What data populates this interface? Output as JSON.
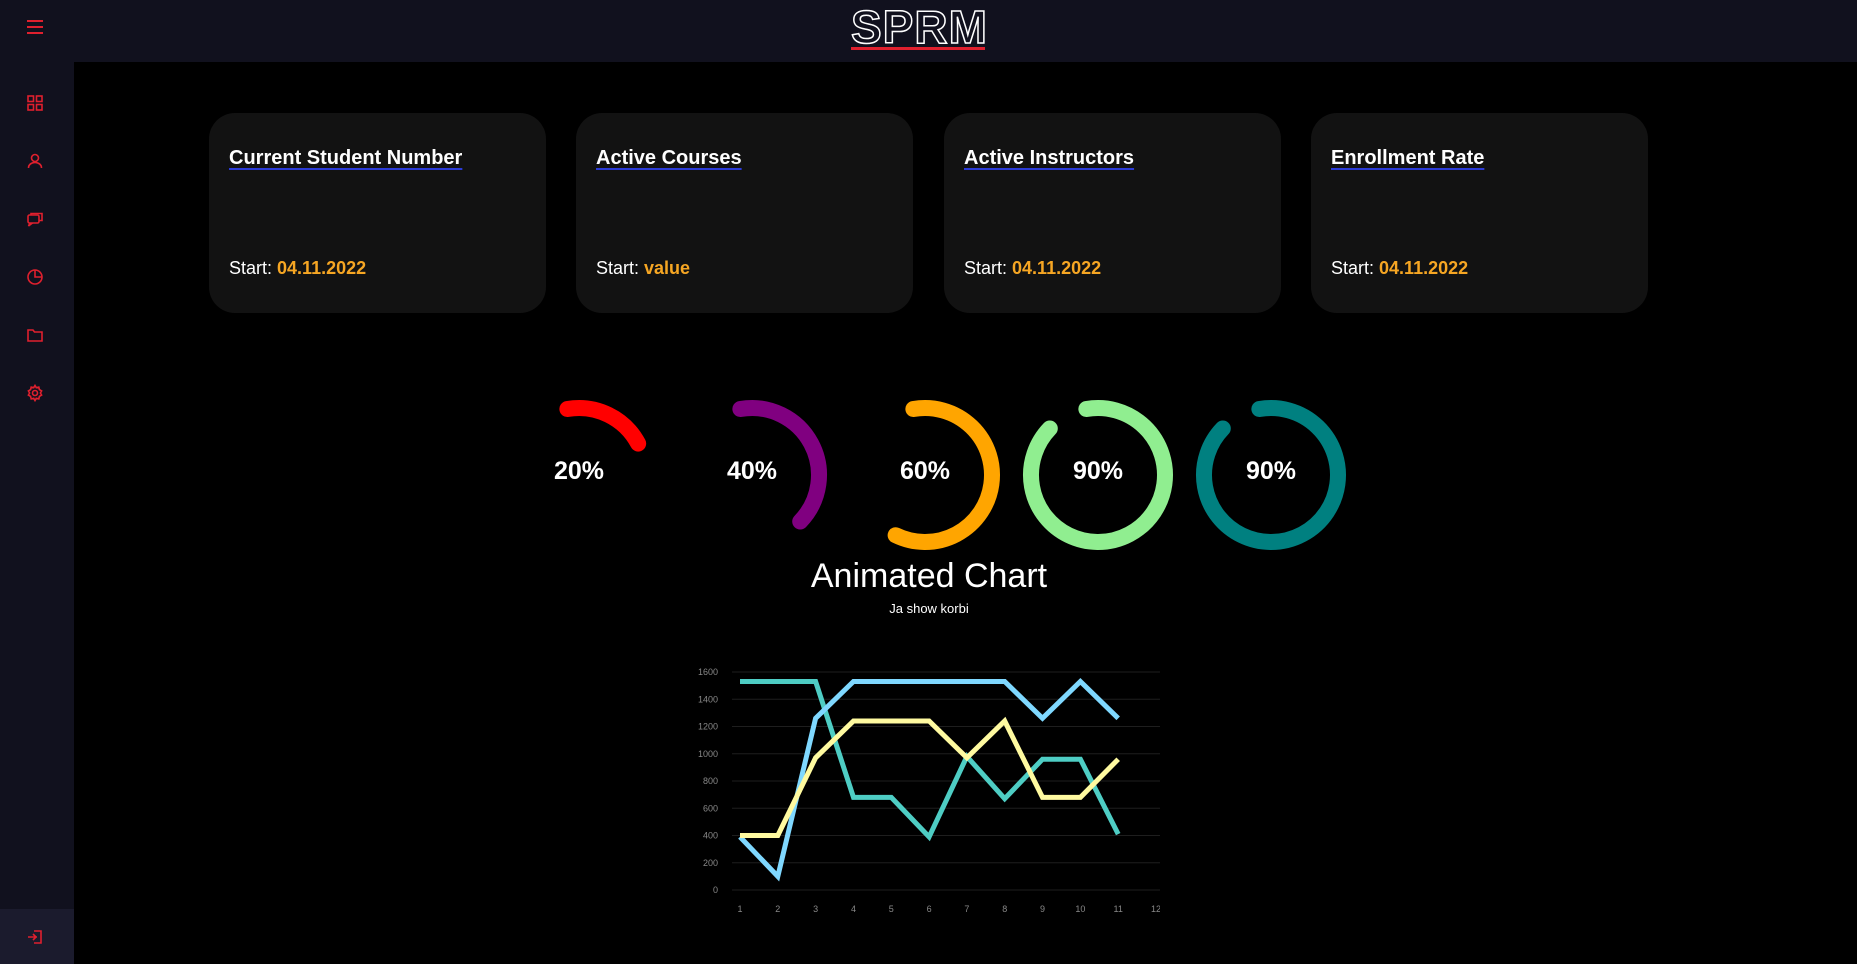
{
  "app": {
    "brand": "SPRM"
  },
  "sidebar": {
    "items": [
      {
        "name": "dashboard",
        "icon": "grid-icon"
      },
      {
        "name": "users",
        "icon": "user-icon"
      },
      {
        "name": "courses",
        "icon": "chat-icon"
      },
      {
        "name": "reports",
        "icon": "pie-chart-icon"
      },
      {
        "name": "files",
        "icon": "folder-icon"
      },
      {
        "name": "settings",
        "icon": "gear-icon"
      }
    ],
    "logout_icon": "logout-icon",
    "accent": "#e0202e"
  },
  "cards": [
    {
      "title": "Current Student Number",
      "start_label": "Start:",
      "start_value": "04.11.2022"
    },
    {
      "title": "Active Courses",
      "start_label": "Start:",
      "start_value": "value"
    },
    {
      "title": "Active Instructors",
      "start_label": "Start:",
      "start_value": "04.11.2022"
    },
    {
      "title": "Enrollment Rate",
      "start_label": "Start:",
      "start_value": "04.11.2022"
    }
  ],
  "progress_rings": [
    {
      "label": "20%",
      "value": 20,
      "color": "#ff0000"
    },
    {
      "label": "40%",
      "value": 40,
      "color": "#800080"
    },
    {
      "label": "60%",
      "value": 60,
      "color": "#ffa500"
    },
    {
      "label": "90%",
      "value": 90,
      "color": "#90ee90"
    },
    {
      "label": "90%",
      "value": 90,
      "color": "#008080"
    }
  ],
  "chart": {
    "title": "Animated Chart",
    "subtitle": "Ja show korbi"
  },
  "chart_data": {
    "type": "line",
    "title": "Animated Chart",
    "subtitle": "Ja show korbi",
    "x": [
      1,
      2,
      3,
      4,
      5,
      6,
      7,
      8,
      9,
      10,
      11,
      12
    ],
    "ylim": [
      0,
      1600
    ],
    "yticks": [
      0,
      200,
      400,
      600,
      800,
      1000,
      1200,
      1400,
      1600
    ],
    "grid": true,
    "series": [
      {
        "color": "#4ecdc4",
        "values": [
          1530,
          1530,
          1530,
          680,
          680,
          390,
          980,
          670,
          960,
          960,
          410
        ]
      },
      {
        "color": "#7fd8ff",
        "values": [
          390,
          100,
          1260,
          1530,
          1530,
          1530,
          1530,
          1530,
          1260,
          1530,
          1260
        ]
      },
      {
        "color": "#fffaa0",
        "values": [
          400,
          400,
          970,
          1240,
          1240,
          1240,
          970,
          1240,
          680,
          680,
          960
        ]
      }
    ]
  }
}
